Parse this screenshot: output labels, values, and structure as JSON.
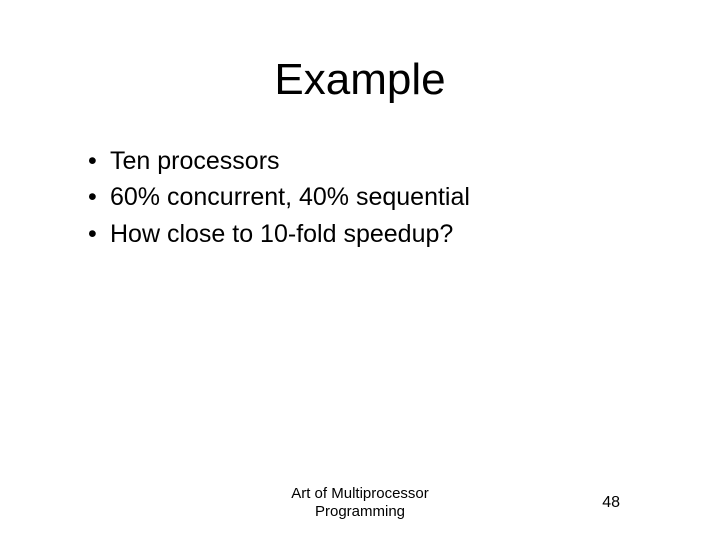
{
  "title": "Example",
  "bullets": [
    "Ten processors",
    "60% concurrent, 40% sequential",
    "How close to 10-fold speedup?"
  ],
  "footer": {
    "line1": "Art of Multiprocessor",
    "line2": "Programming"
  },
  "page_number": "48"
}
